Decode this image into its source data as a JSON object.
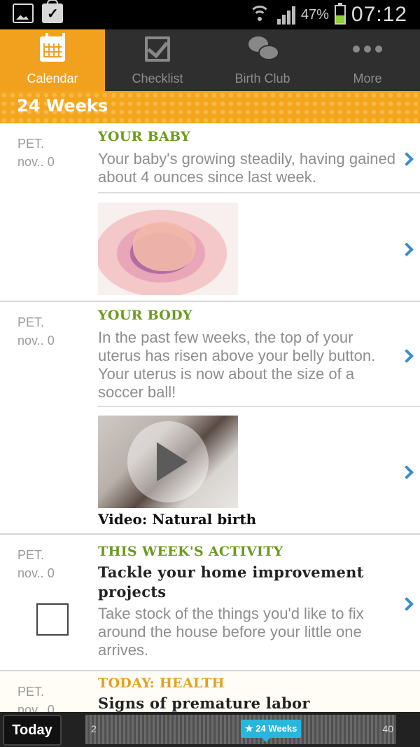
{
  "status_bar": {
    "battery_pct": "47%",
    "battery_level": 0.47,
    "time": "07:12"
  },
  "tabs": [
    {
      "label": "Calendar",
      "icon": "calendar-icon",
      "active": true
    },
    {
      "label": "Checklist",
      "icon": "checklist-icon",
      "active": false
    },
    {
      "label": "Birth Club",
      "icon": "chat-bubbles-icon",
      "active": false
    },
    {
      "label": "More",
      "icon": "more-dots-icon",
      "active": false
    }
  ],
  "week_header": "24 Weeks",
  "entries": [
    {
      "date_day": "PET.",
      "date_month": "nov.. 0",
      "category": "YOUR BABY",
      "text": "Your baby's growing steadily, having gained about 4 ounces since last week."
    },
    {
      "date_day": "PET.",
      "date_month": "nov.. 0",
      "category": "YOUR BODY",
      "text": "In the past few weeks, the top of your uterus has risen above your belly button. Your uterus is now about the size of a soccer ball!",
      "video_caption": "Video: Natural birth"
    },
    {
      "date_day": "PET.",
      "date_month": "nov.. 0",
      "category": "THIS WEEK'S ACTIVITY",
      "title": "Tackle your home improvement projects",
      "text": "Take stock of the things you'd like to fix around the house before your little one arrives."
    },
    {
      "date_day": "PET.",
      "date_month": "nov.. 0",
      "category": "TODAY: HEALTH",
      "title": "Signs of premature labor"
    }
  ],
  "bottom_bar": {
    "today_label": "Today",
    "timeline_start": "2",
    "timeline_end": "40",
    "current_marker": "★ 24 Weeks"
  },
  "colors": {
    "accent": "#f1a11d",
    "category_green": "#6c9a1e",
    "category_orange": "#e6a021",
    "chevron": "#3a8ec8",
    "marker": "#28b7dc"
  }
}
